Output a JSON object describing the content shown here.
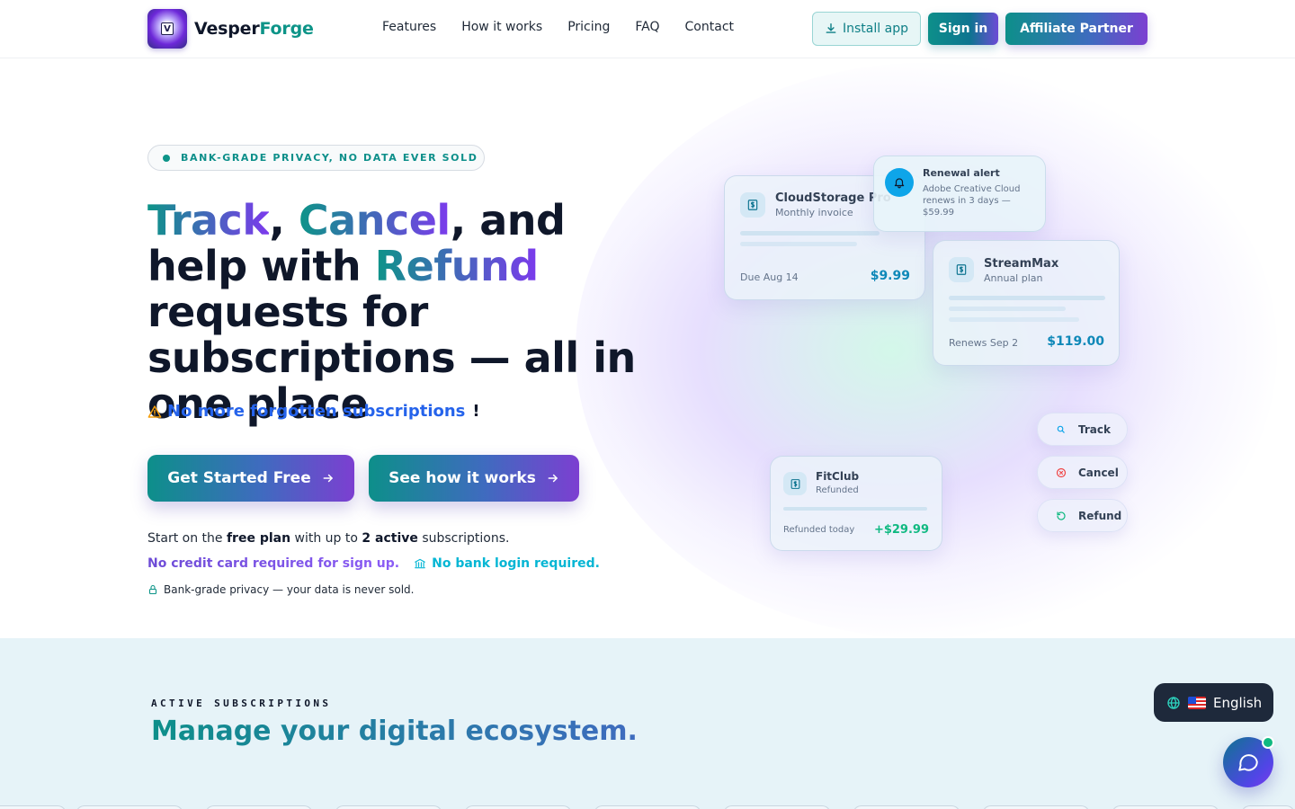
{
  "brand": {
    "name_part1": "Vesper",
    "name_part2": "Forge",
    "logo_letter": "V"
  },
  "nav": {
    "links": [
      "Features",
      "How it works",
      "Pricing",
      "FAQ",
      "Contact"
    ],
    "install_label": "Install app",
    "signin_label": "Sign in",
    "affiliate_label": "Affiliate Partner"
  },
  "hero": {
    "badge": "BANK-GRADE PRIVACY, NO DATA EVER SOLD",
    "headline": {
      "w1": "Track",
      "sep1": ", ",
      "w2": "Cancel",
      "mid": ", and help with ",
      "w3": "Refund",
      "rest": " requests for subscriptions — all in one place"
    },
    "tagline": "No more forgotten subscriptions",
    "tagline_mark": "!",
    "cta_primary": "Get Started Free",
    "cta_secondary": "See how it works",
    "note_plan": {
      "a": "Start on the ",
      "b": "free plan",
      "c": " with up to ",
      "d": "2 active",
      "e": " subscriptions."
    },
    "note_card": "No credit card required for sign up.",
    "note_bank": "No bank login required.",
    "note_privacy": "Bank-grade privacy — your data is never sold."
  },
  "cards": [
    {
      "name": "CloudStorage Pro",
      "plan": "Monthly invoice",
      "footer": "Due Aug 14",
      "amount": "$9.99"
    },
    {
      "name": "StreamMax",
      "plan": "Annual plan",
      "footer": "Renews Sep 2",
      "amount": "$119.00"
    },
    {
      "name": "FitClub",
      "plan": "Refunded",
      "footer": "Refunded today",
      "amount": "+$29.99"
    }
  ],
  "alert": {
    "title": "Renewal alert",
    "body": "Adobe Creative Cloud renews in 3 days — $59.99"
  },
  "actions": [
    "Track",
    "Cancel",
    "Refund"
  ],
  "section": {
    "eyebrow": "ACTIVE SUBSCRIPTIONS",
    "title": "Manage your digital ecosystem."
  },
  "language": {
    "label": "English"
  },
  "colors": {
    "teal": "#0d9488",
    "purple": "#7c3aed",
    "navy": "#1e293b",
    "success": "#10b981",
    "section_bg": "#e6f3f8"
  }
}
